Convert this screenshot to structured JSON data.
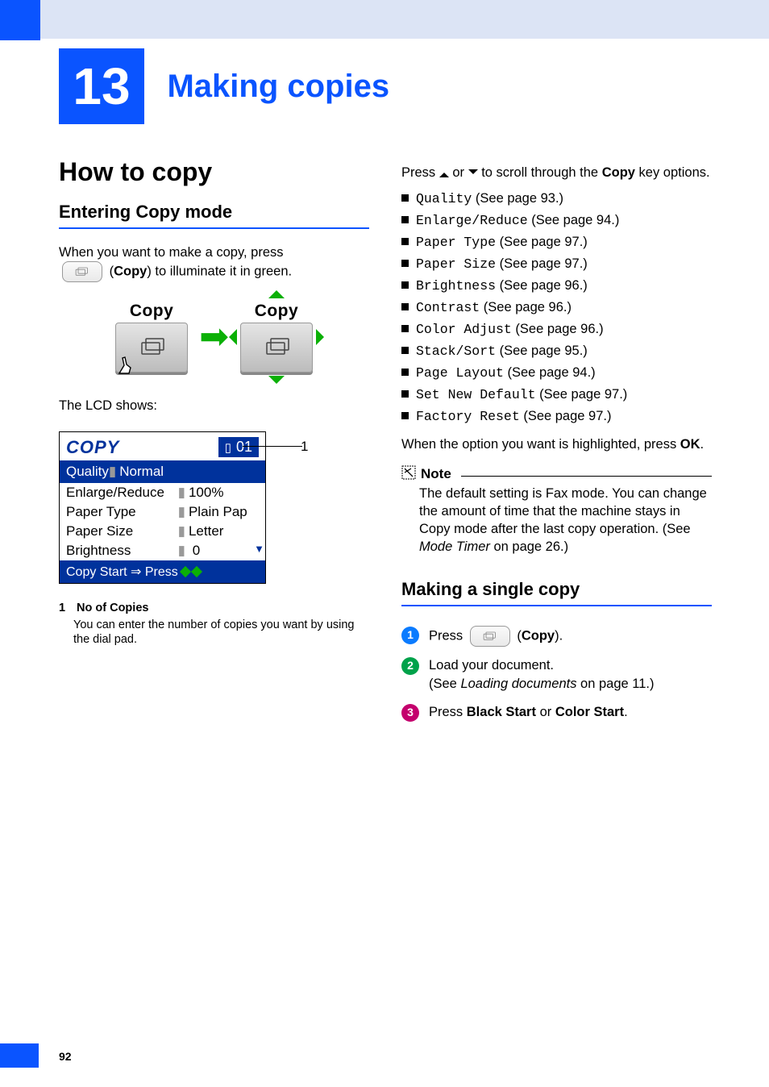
{
  "chapter": {
    "number": "13",
    "title": "Making copies"
  },
  "left": {
    "h1": "How to copy",
    "h2": "Entering Copy mode",
    "intro1": "When you want to make a copy, press ",
    "intro_copy": "Copy",
    "intro2": ") to illuminate it in green.",
    "copy_label": "Copy",
    "lcd_caption": "The LCD shows:",
    "lcd": {
      "title": "COPY",
      "count": "01",
      "selected": {
        "key": "Quality",
        "value": "Normal"
      },
      "rows": [
        {
          "key": "Enlarge/Reduce",
          "value": "100%"
        },
        {
          "key": "Paper Type",
          "value": "Plain Pap"
        },
        {
          "key": "Paper Size",
          "value": "Letter"
        },
        {
          "key": "Brightness",
          "value": "0"
        }
      ],
      "footer_lead": "Copy Start  ⇒ Press"
    },
    "callout": "1",
    "footnote_num": "1",
    "footnote_title": "No of Copies",
    "footnote_body": "You can enter the number of copies you want by using the dial pad."
  },
  "right": {
    "scroll_pre": "Press ",
    "scroll_mid": " or ",
    "scroll_post": " to scroll through the ",
    "scroll_bold": "Copy",
    "scroll_tail": " key options.",
    "options": [
      {
        "mono": "Quality",
        "rest": " (See page 93.)"
      },
      {
        "mono": "Enlarge/Reduce",
        "rest": " (See page 94.)"
      },
      {
        "mono": "Paper Type",
        "rest": " (See page 97.)"
      },
      {
        "mono": "Paper Size",
        "rest": " (See page 97.)"
      },
      {
        "mono": "Brightness",
        "rest": " (See page 96.)"
      },
      {
        "mono": "Contrast",
        "rest": " (See page 96.)"
      },
      {
        "mono": "Color Adjust",
        "rest": " (See page 96.)"
      },
      {
        "mono": "Stack/Sort",
        "rest": " (See page 95.)"
      },
      {
        "mono": "Page Layout",
        "rest": " (See page 94.)"
      },
      {
        "mono": "Set New Default",
        "rest": " (See page 97.)"
      },
      {
        "mono": "Factory Reset",
        "rest": " (See page 97.)"
      }
    ],
    "highlight1": "When the option you want is highlighted, press ",
    "highlight_ok": "OK",
    "highlight2": ".",
    "note_label": "Note",
    "note_body1": "The default setting is Fax mode. You can change the amount of time that the machine stays in Copy mode after the last copy operation. (See ",
    "note_italic": "Mode Timer",
    "note_body2": " on page 26.)",
    "h2": "Making a single copy",
    "steps": [
      {
        "n": "1",
        "pre": "Press ",
        "bold": "Copy",
        "post": ")."
      },
      {
        "n": "2",
        "line1": "Load your document.",
        "line2_pre": "(See ",
        "line2_italic": "Loading documents",
        "line2_post": " on page 11.)"
      },
      {
        "n": "3",
        "pre": "Press ",
        "b1": "Black Start",
        "mid": " or ",
        "b2": "Color Start",
        "post": "."
      }
    ]
  },
  "page_number": "92"
}
